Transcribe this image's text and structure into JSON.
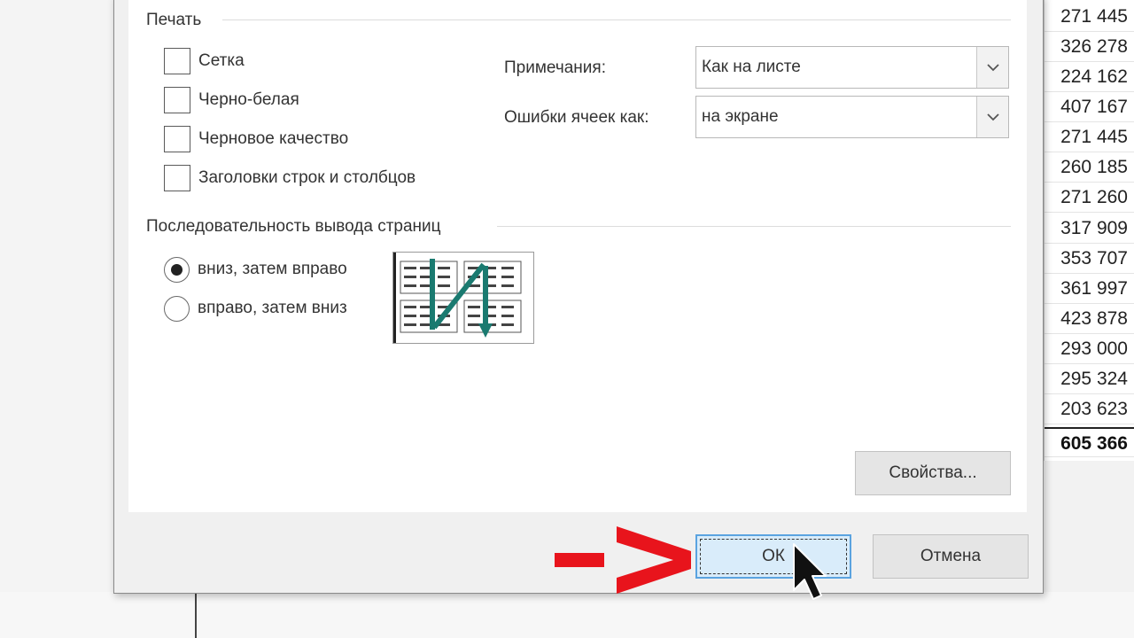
{
  "sheet": {
    "numbers": [
      "271 445",
      "326 278",
      "224 162",
      "407 167",
      "271 445",
      "260 185",
      "271 260",
      "317 909",
      "353 707",
      "361 997",
      "423 878",
      "293 000",
      "295 324",
      "203 623"
    ],
    "total": "605 366"
  },
  "dialog": {
    "print_group": {
      "title": "Печать",
      "gridlines": "Сетка",
      "black_white": "Черно-белая",
      "draft": "Черновое качество",
      "headings": "Заголовки строк и столбцов"
    },
    "comments": {
      "label": "Примечания:",
      "value": "Как на листе"
    },
    "errors": {
      "label": "Ошибки ячеек как:",
      "value": "на экране"
    },
    "page_order": {
      "title": "Последовательность вывода страниц",
      "down_then_over": "вниз, затем вправо",
      "over_then_down": "вправо, затем вниз"
    },
    "properties_button": "Свойства...",
    "ok_button": "ОК",
    "cancel_button": "Отмена"
  },
  "colors": {
    "annotation_arrow": "#e8141c",
    "order_arrow": "#1a7a70",
    "ok_border": "#5aa3e0"
  }
}
